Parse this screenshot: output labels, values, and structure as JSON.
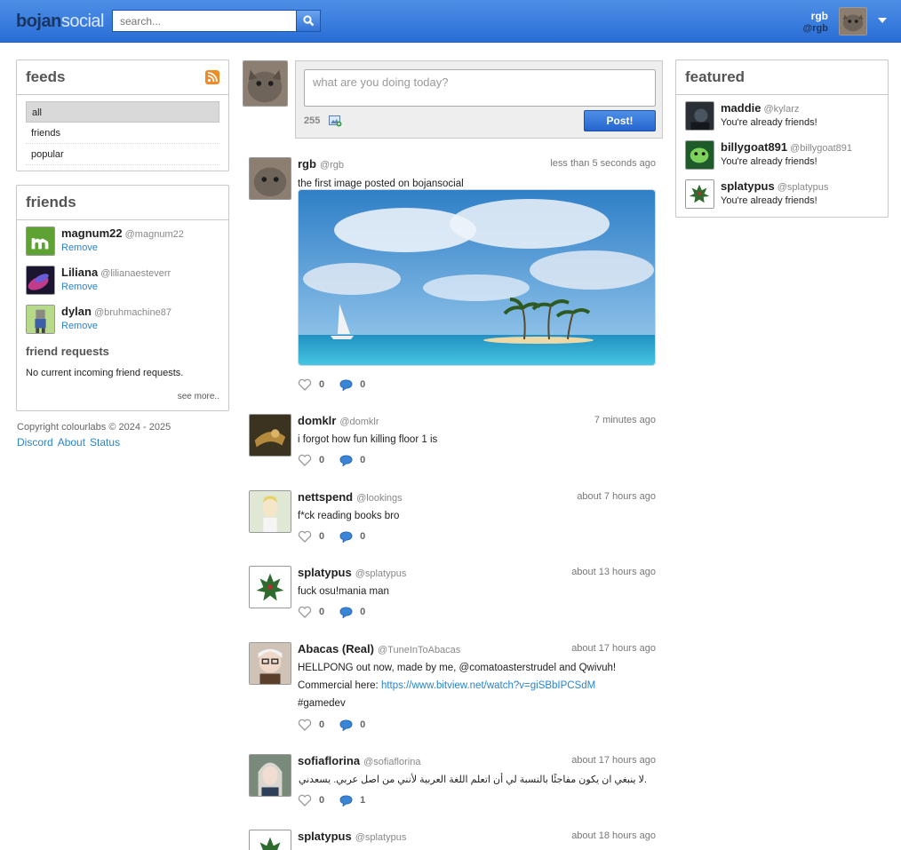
{
  "header": {
    "logo_part1": "bojan",
    "logo_part2": "social",
    "search_placeholder": "search...",
    "user_name": "rgb",
    "user_handle": "@rgb"
  },
  "feeds": {
    "title": "feeds",
    "items": [
      {
        "label": "all",
        "active": true
      },
      {
        "label": "friends",
        "active": false
      },
      {
        "label": "popular",
        "active": false
      }
    ]
  },
  "friends": {
    "title": "friends",
    "list": [
      {
        "name": "magnum22",
        "handle": "@magnum22",
        "action": "Remove"
      },
      {
        "name": "Liliana",
        "handle": "@lilianaesteverr",
        "action": "Remove"
      },
      {
        "name": "dylan",
        "handle": "@bruhmachine87",
        "action": "Remove"
      }
    ],
    "requests_title": "friend requests",
    "requests_text": "No current incoming friend requests.",
    "see_more": "see more.."
  },
  "footer": {
    "copyright": "Copyright colourlabs © 2024 - 2025",
    "links": [
      "Discord",
      "About",
      "Status"
    ]
  },
  "composer": {
    "placeholder": "what are you doing today?",
    "counter": "255",
    "post_label": "Post!"
  },
  "posts": [
    {
      "name": "rgb",
      "handle": "@rgb",
      "time": "less than 5 seconds ago",
      "text": "the first image posted on bojansocial",
      "likes": "0",
      "comments": "0"
    },
    {
      "name": "domklr",
      "handle": "@domklr",
      "time": "7 minutes ago",
      "text": "i forgot how fun killing floor 1 is",
      "likes": "0",
      "comments": "0"
    },
    {
      "name": "nettspend",
      "handle": "@lookings",
      "time": "about 7 hours ago",
      "text": "f*ck reading books bro",
      "likes": "0",
      "comments": "0"
    },
    {
      "name": "splatypus",
      "handle": "@splatypus",
      "time": "about 13 hours ago",
      "text": "fuck osu!mania man",
      "likes": "0",
      "comments": "0"
    },
    {
      "name": "Abacas (Real)",
      "handle": "@TuneInToAbacas",
      "time": "about 17 hours ago",
      "text_line1": "HELLPONG out now, made by me, @comatoasterstrudel and Qwivuh!",
      "text_line2_prefix": "Commercial here: ",
      "text_link": "https://www.bitview.net/watch?v=giSBbIPCSdM",
      "text_line3": "#gamedev",
      "likes": "0",
      "comments": "0"
    },
    {
      "name": "sofiaflorina",
      "handle": "@sofiaflorina",
      "time": "about 17 hours ago",
      "text": ".لا ينبغي ان يكون مفاجئًا بالنسبة لي أن اتعلم اللغة العربية لأنني من اصل عربي. يسعدني أن أعرف ذلك",
      "likes": "0",
      "comments": "1"
    },
    {
      "name": "splatypus",
      "handle": "@splatypus",
      "time": "about 18 hours ago"
    }
  ],
  "featured": {
    "title": "featured",
    "list": [
      {
        "name": "maddie",
        "handle": "@kylarz",
        "status": "You're already friends!"
      },
      {
        "name": "billygoat891",
        "handle": "@billygoat891",
        "status": "You're already friends!"
      },
      {
        "name": "splatypus",
        "handle": "@splatypus",
        "status": "You're already friends!"
      }
    ]
  },
  "colors": {
    "brand": "#2a6ed6",
    "link": "#2a84cc",
    "rss": "#f08a24"
  }
}
